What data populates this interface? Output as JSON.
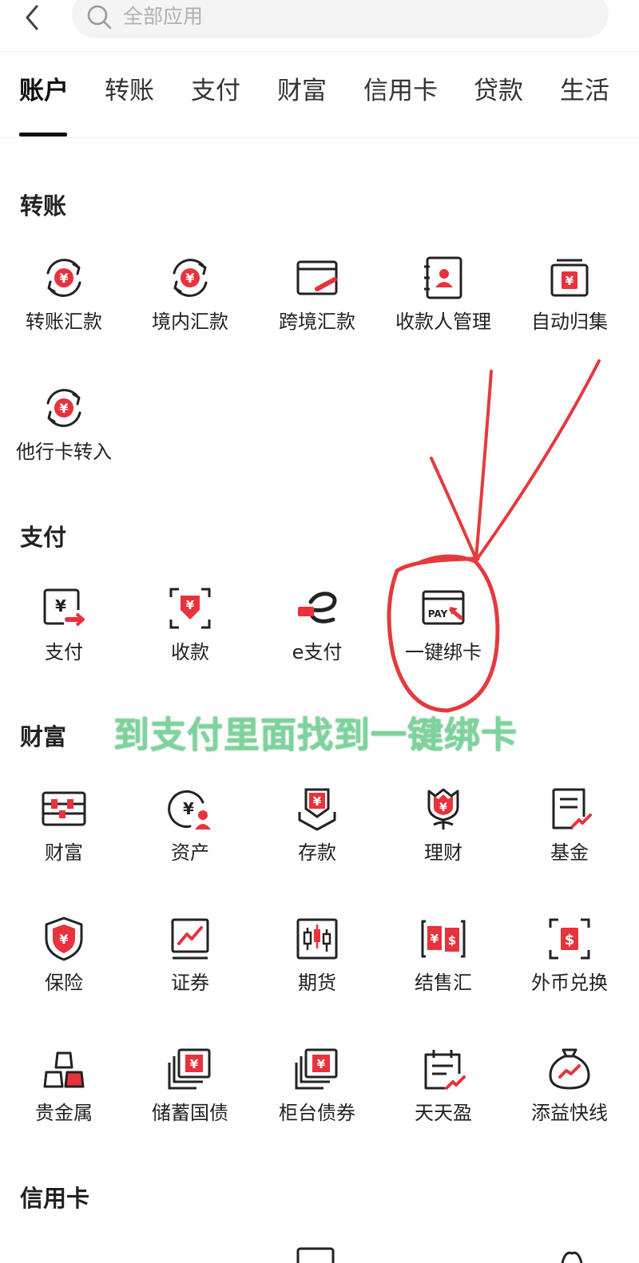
{
  "search": {
    "placeholder": "全部应用"
  },
  "tabs": [
    "账户",
    "转账",
    "支付",
    "财富",
    "信用卡",
    "贷款",
    "生活"
  ],
  "sections": {
    "transfer": {
      "title": "转账",
      "items": [
        "转账汇款",
        "境内汇款",
        "跨境汇款",
        "收款人管理",
        "自动归集",
        "他行卡转入"
      ]
    },
    "payment": {
      "title": "支付",
      "items": [
        "支付",
        "收款",
        "e支付",
        "一键绑卡"
      ]
    },
    "wealth": {
      "title": "财富",
      "items": [
        "财富",
        "资产",
        "存款",
        "理财",
        "基金",
        "保险",
        "证券",
        "期货",
        "结售汇",
        "外币兑换",
        "贵金属",
        "储蓄国债",
        "柜台债券",
        "天天盈",
        "添益快线"
      ]
    },
    "credit": {
      "title": "信用卡"
    }
  },
  "annotation": {
    "text": "到支付里面找到一键绑卡"
  },
  "icons": {
    "transfer": [
      "cycle-yuan-icon",
      "cycle-yuan-icon",
      "cross-border-card-icon",
      "payee-contact-icon",
      "auto-collect-icon",
      "cycle-yuan-icon"
    ],
    "payment": [
      "yuan-card-arrow-icon",
      "receive-scan-icon",
      "e-pay-icon",
      "pay-card-bind-icon"
    ],
    "wealth": [
      "wealth-abacus-icon",
      "assets-yuan-user-icon",
      "deposit-shield-icon",
      "lotus-yuan-icon",
      "fund-document-icon",
      "insurance-shield-icon",
      "securities-chart-icon",
      "futures-candlestick-icon",
      "exchange-yuan-dollar-icon",
      "foreign-currency-icon",
      "gold-bars-icon",
      "savings-bond-icon",
      "counter-bond-icon",
      "calendar-trend-icon",
      "money-bag-icon"
    ]
  },
  "colors": {
    "accent": "#e8323c",
    "annotation": "#7dd39c",
    "text": "#1a1a1a"
  }
}
